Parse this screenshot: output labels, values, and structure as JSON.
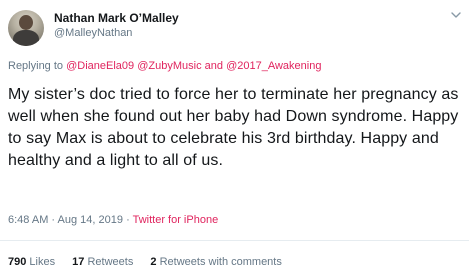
{
  "author": {
    "display_name": "Nathan Mark O’Malley",
    "handle": "@MalleyNathan"
  },
  "reply": {
    "prefix": "Replying to",
    "mentions": [
      "@DianeEla09",
      "@ZubyMusic",
      "@2017_Awakening"
    ],
    "conjunction": "and"
  },
  "tweet": {
    "text": "My sister’s doc tried to force her to terminate her pregnancy as well when she found out her baby had Down syndrome. Happy to say Max is about to celebrate his 3rd birthday. Happy and healthy and a light to all of us."
  },
  "meta": {
    "time": "6:48 AM",
    "date": "Aug 14, 2019",
    "source": "Twitter for iPhone",
    "separator": "·"
  },
  "stats": {
    "likes_count": "790",
    "likes_label": "Likes",
    "retweets_count": "17",
    "retweets_label": "Retweets",
    "comments_count": "2",
    "comments_label": "Retweets with comments"
  },
  "icons": {
    "menu": "chevron-down-icon"
  },
  "colors": {
    "link": "#e0245e",
    "secondary": "#657786",
    "text": "#14171a"
  }
}
